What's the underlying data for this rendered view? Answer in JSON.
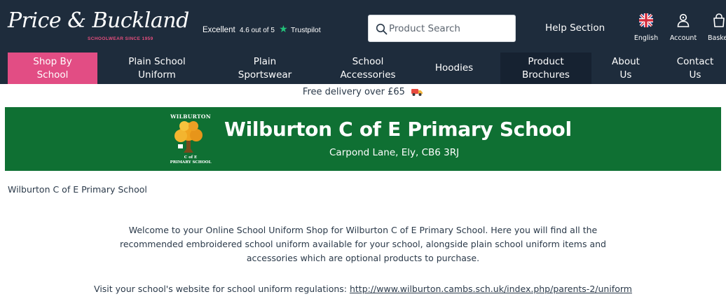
{
  "header": {
    "logo_text": "Price & Buckland",
    "logo_tagline": "SCHOOLWEAR SINCE 1959",
    "trustpilot": {
      "rating_word": "Excellent",
      "score_text": "4.6 out of 5",
      "brand": "Trustpilot",
      "star_color": "#22c27a"
    },
    "search": {
      "placeholder": "Product Search",
      "value": ""
    },
    "help_label": "Help Section",
    "language_label": "English",
    "account_label": "Account",
    "basket_label": "Basket"
  },
  "nav": {
    "items": [
      {
        "line1": "Shop By",
        "line2": "School"
      },
      {
        "line1": "Plain School",
        "line2": "Uniform"
      },
      {
        "line1": "Plain",
        "line2": "Sportswear"
      },
      {
        "line1": "School",
        "line2": "Accessories"
      },
      {
        "line1": "Hoodies",
        "line2": ""
      },
      {
        "line1": "Product",
        "line2": "Brochures"
      },
      {
        "line1": "About",
        "line2": "Us"
      },
      {
        "line1": "Contact",
        "line2": "Us"
      }
    ],
    "active_color": "#e24d84"
  },
  "delivery": {
    "text": "Free delivery over £65",
    "icon": "truck-icon"
  },
  "school": {
    "name": "Wilburton C of E Primary School",
    "address": "Carpond Lane, Ely, CB6 3RJ",
    "crest_top": "WILBURTON",
    "crest_sub1": "C of E",
    "crest_sub2": "PRIMARY SCHOOL",
    "banner_color": "#0f7033"
  },
  "breadcrumb": "Wilburton C of E Primary School",
  "intro_text": "Welcome to your Online School Uniform Shop for Wilburton C of E Primary School. Here you will find all the recommended embroidered school uniform available for your school, alongside plain school uniform items and accessories which are optional products to purchase.",
  "visit": {
    "prefix": "Visit your school's website for school uniform regulations: ",
    "link": "http://www.wilburton.cambs.sch.uk/index.php/parents-2/uniform"
  },
  "colors": {
    "header_bg": "#1e2c3c",
    "text": "#2b3a4a"
  }
}
